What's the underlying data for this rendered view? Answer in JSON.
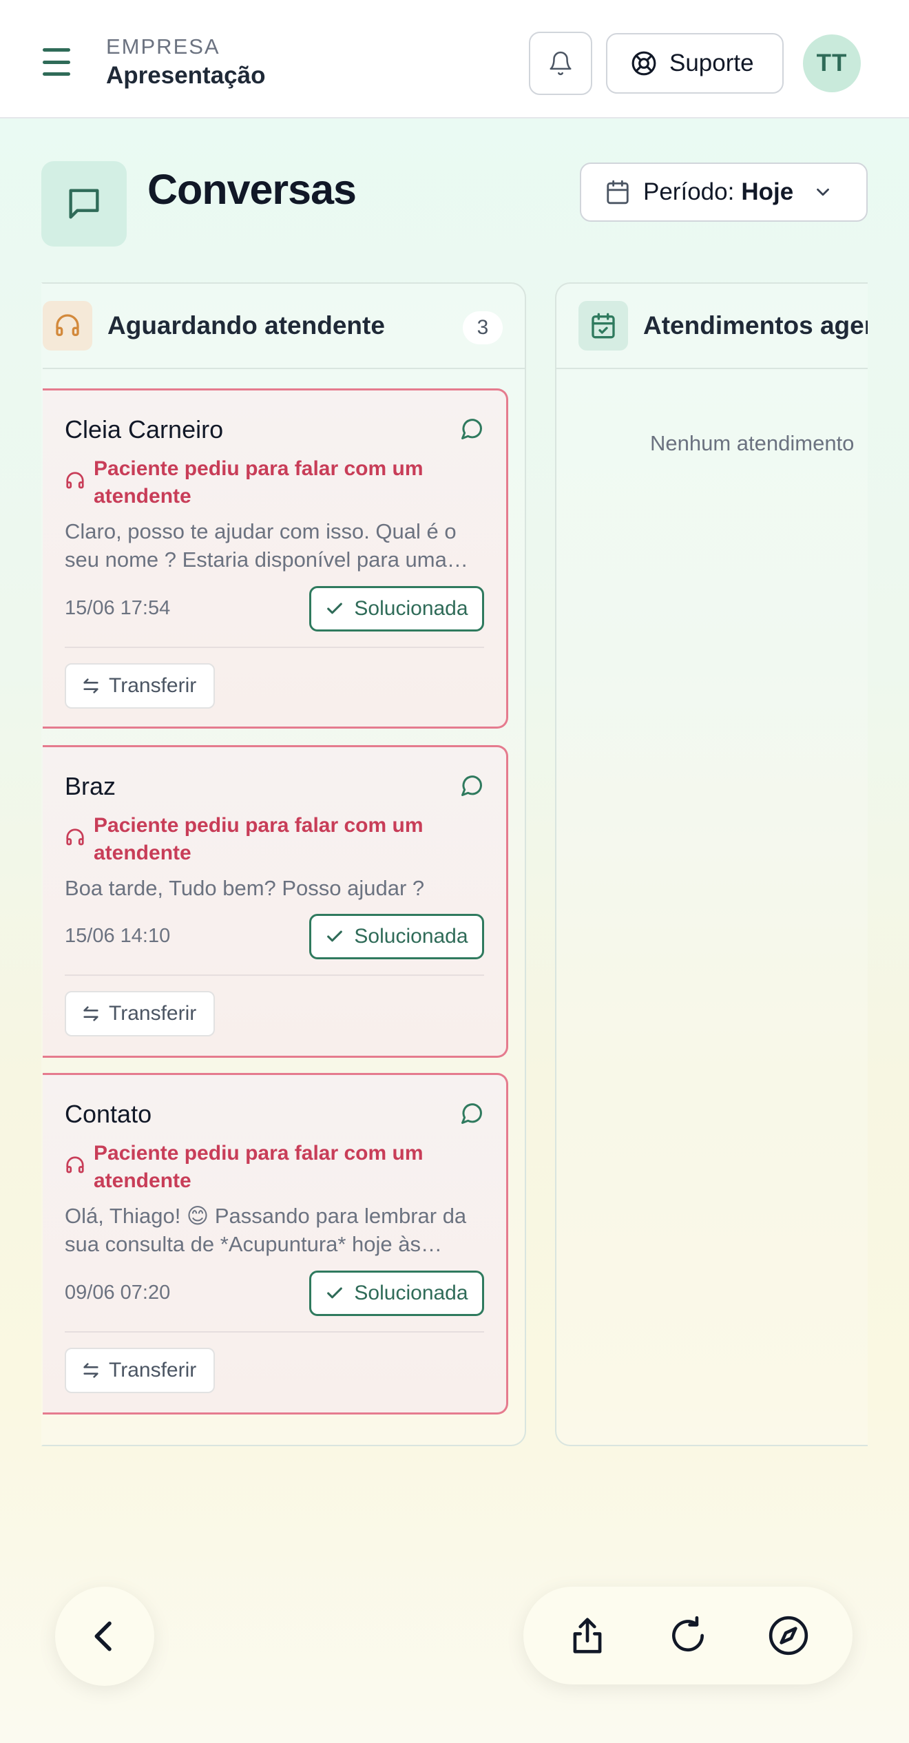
{
  "header": {
    "company_label": "EMPRESA",
    "company_name": "Apresentação",
    "support_label": "Suporte",
    "avatar_initials": "TT"
  },
  "page": {
    "title": "Conversas",
    "period_label": "Período:",
    "period_value": "Hoje"
  },
  "columns": [
    {
      "title": "Aguardando atendente",
      "count": "3",
      "cards": [
        {
          "name": "Cleia Carneiro",
          "alert": "Paciente pediu para falar com um atendente",
          "message": "Claro, posso te ajudar com isso. Qual é o seu nome ? Estaria disponível para uma…",
          "time": "15/06 17:54",
          "solve_label": "Solucionada",
          "transfer_label": "Transferir"
        },
        {
          "name": "Braz",
          "alert": "Paciente pediu para falar com um atendente",
          "message": "Boa tarde, Tudo bem? Posso ajudar ?",
          "time": "15/06 14:10",
          "solve_label": "Solucionada",
          "transfer_label": "Transferir"
        },
        {
          "name": "Contato",
          "alert": "Paciente pediu para falar com um atendente",
          "message": "Olá, Thiago! 😊  Passando para lembrar da sua consulta de *Acupuntura* hoje às…",
          "time": "09/06 07:20",
          "solve_label": "Solucionada",
          "transfer_label": "Transferir"
        }
      ]
    },
    {
      "title": "Atendimentos agen",
      "empty_text": "Nenhum atendimento"
    }
  ],
  "icons": {
    "menu": "menu-icon",
    "bell": "bell-icon",
    "support": "lifebuoy-icon",
    "page": "chat-bubble-icon",
    "period": "calendar-icon",
    "column_waiting": "headset-icon",
    "column_scheduled": "calendar-check-icon",
    "back": "chevron-left-icon",
    "share": "share-icon",
    "reload": "reload-icon",
    "compass": "compass-icon"
  },
  "colors": {
    "brand_green": "#2f6b58",
    "alert_red": "#c83d58",
    "card_border": "#e57b8e"
  }
}
